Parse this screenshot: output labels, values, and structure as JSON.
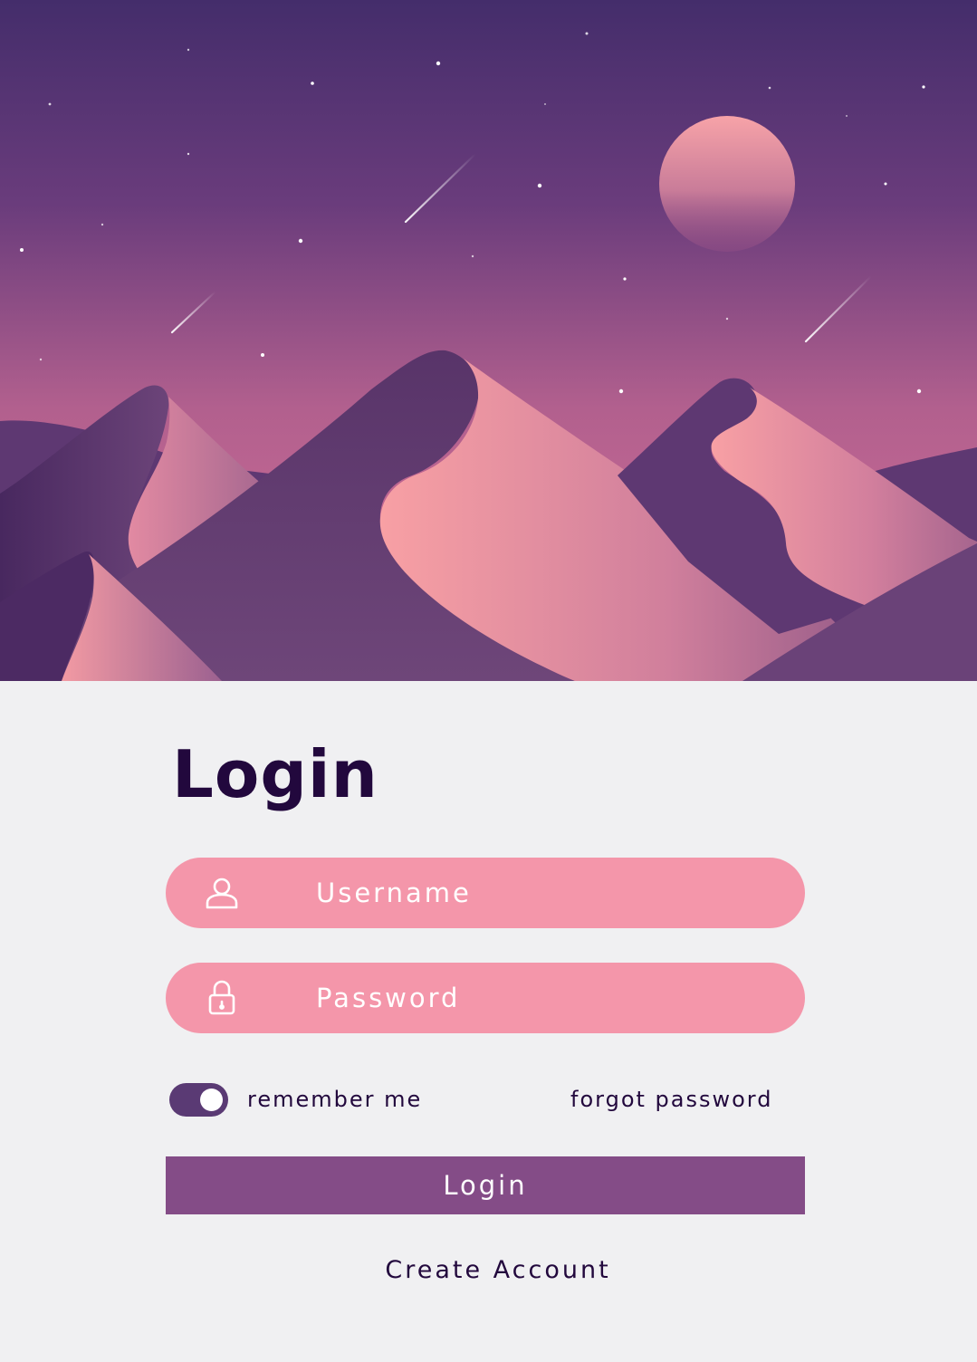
{
  "login_form": {
    "title": "Login",
    "username": {
      "placeholder": "Username",
      "icon": "user-icon"
    },
    "password": {
      "placeholder": "Password",
      "icon": "lock-icon"
    },
    "remember_me": {
      "label": "remember me",
      "enabled": true
    },
    "forgot_password_label": "forgot password",
    "login_button_label": "Login",
    "create_account_label": "Create Account"
  },
  "colors": {
    "sky_top": "#442d6b",
    "sky_bottom": "#d56f97",
    "moon": "#f4a0a8",
    "dune_shadow": "#5e3872",
    "dune_light": "#f5a0a6",
    "input_fill": "#f496aa",
    "button_fill": "#844c87",
    "toggle_fill": "#5a3a74",
    "title_text": "#22083d",
    "panel_background": "#f0f0f2"
  }
}
